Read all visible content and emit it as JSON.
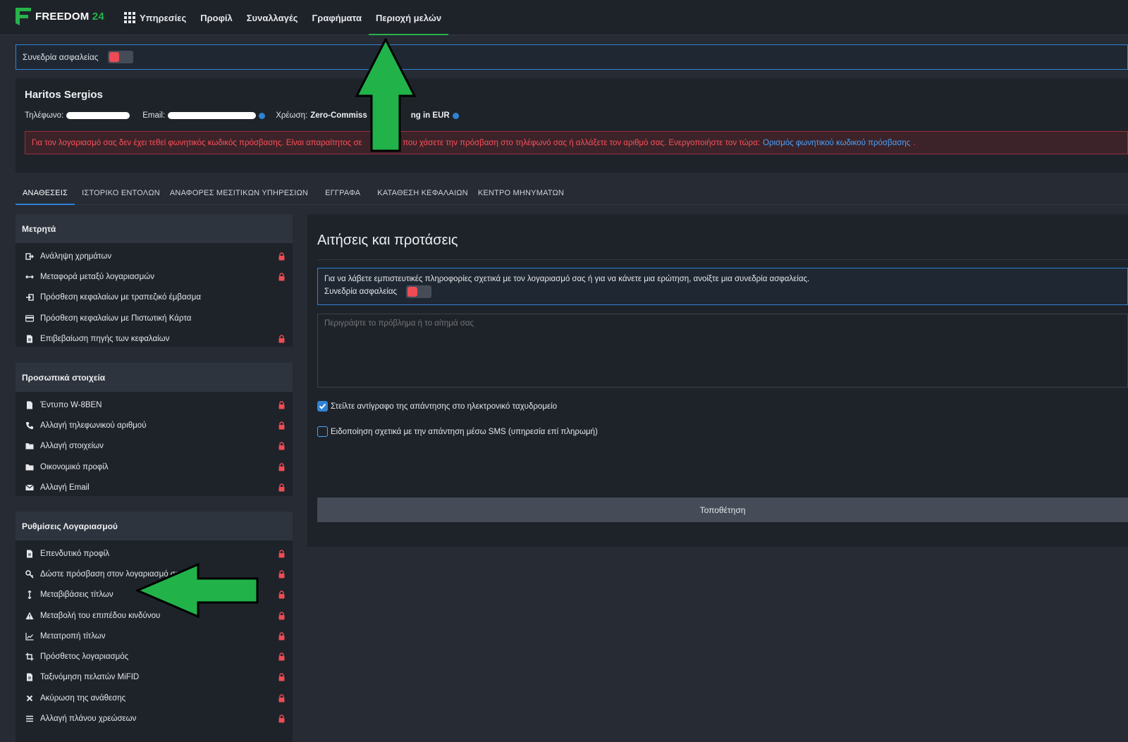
{
  "brand": {
    "name": "FREEDOM",
    "number": "24",
    "green": "#27b24a"
  },
  "nav": [
    {
      "label": "Υπηρεσίες",
      "icon": "apps-grid-icon",
      "active": false
    },
    {
      "label": "Προφίλ",
      "active": false
    },
    {
      "label": "Συναλλαγές",
      "active": false
    },
    {
      "label": "Γραφήματα",
      "active": false
    },
    {
      "label": "Περιοχή μελών",
      "active": true
    }
  ],
  "security_bar": {
    "label": "Συνεδρία ασφαλείας",
    "toggle_on": false
  },
  "profile": {
    "name": "Haritos Sergios",
    "phone_label": "Τηλέφωνο:",
    "email_label": "Email:",
    "charge_label": "Χρέωση:",
    "charge_value": "Zero-Commiss",
    "charge_value_tail": "ng in EUR",
    "warning_text": "Για τον λογαριασμό σας δεν έχει τεθεί φωνητικός κωδικός πρόσβασης. Είναι απαραίτητος σε",
    "warning_text_tail": "η που χάσετε την πρόσβαση στο τηλέφωνό σας ή αλλάξετε τον αριθμό σας. Ενεργοποιήστε τον τώρα:",
    "warning_link": "Ορισμός φωνητικού κωδικού πρόσβασης",
    "warning_end": "."
  },
  "tabs": [
    {
      "label": "ΑΝΑΘΕΣΕΙΣ",
      "active": true
    },
    {
      "label": "ΙΣΤΟΡΙΚΟ ΕΝΤΟΛΩΝ"
    },
    {
      "label": "ΑΝΑΦΟΡΕΣ ΜΕΣΙΤΙΚΩΝ ΥΠΗΡΕΣΙΩΝ"
    },
    {
      "label": "ΕΓΓΡΑΦΑ"
    },
    {
      "label": "ΚΑΤΑΘΕΣΗ ΚΕΦΑΛΑΙΩΝ"
    },
    {
      "label": "ΚΕΝΤΡΟ ΜΗΝΥΜΑΤΩΝ"
    }
  ],
  "sidebar": {
    "cash": {
      "title": "Μετρητά",
      "items": [
        {
          "label": "Ανάληψη χρημάτων",
          "icon": "withdraw-icon",
          "locked": true
        },
        {
          "label": "Μεταφορά μεταξύ λογαριασμών",
          "icon": "transfer-icon",
          "locked": true
        },
        {
          "label": "Πρόσθεση κεφαλαίων με τραπεζικό έμβασμα",
          "icon": "deposit-icon",
          "locked": false
        },
        {
          "label": "Πρόσθεση κεφαλαίων με Πιστωτική Κάρτα",
          "icon": "credit-card-icon",
          "locked": false
        },
        {
          "label": "Επιβεβαίωση πηγής των κεφαλαίων",
          "icon": "document-icon",
          "locked": true
        }
      ]
    },
    "personal": {
      "title": "Προσωπικά στοιχεία",
      "items": [
        {
          "label": "Έντυπο W-8BEN",
          "icon": "document-icon",
          "locked": true
        },
        {
          "label": "Αλλαγή τηλεφωνικού αριθμού",
          "icon": "phone-icon",
          "locked": true
        },
        {
          "label": "Αλλαγή στοιχείων",
          "icon": "folder-icon",
          "locked": true
        },
        {
          "label": "Οικονομικό προφίλ",
          "icon": "folder-icon",
          "locked": true
        },
        {
          "label": "Αλλαγή Email",
          "icon": "envelope-icon",
          "locked": true
        }
      ]
    },
    "account": {
      "title": "Ρυθμίσεις Λογαριασμού",
      "items": [
        {
          "label": "Επενδυτικό προφίλ",
          "icon": "document-icon",
          "locked": true
        },
        {
          "label": "Δώστε πρόσβαση στον λογαριασμό σας",
          "icon": "key-icon",
          "locked": true
        },
        {
          "label": "Μεταβιβάσεις τίτλων",
          "icon": "vertical-arrows-icon",
          "locked": true
        },
        {
          "label": "Μεταβολή του επιπέδου κινδύνου",
          "icon": "warning-icon",
          "locked": true
        },
        {
          "label": "Μετατροπή τίτλων",
          "icon": "line-chart-icon",
          "locked": true
        },
        {
          "label": "Πρόσθετος λογαριασμός",
          "icon": "crop-icon",
          "locked": true
        },
        {
          "label": "Ταξινόμηση πελατών MiFID",
          "icon": "document-icon",
          "locked": true
        },
        {
          "label": "Ακύρωση της ανάθεσης",
          "icon": "cross-icon",
          "locked": true
        },
        {
          "label": "Αλλαγή πλάνου χρεώσεων",
          "icon": "list-icon",
          "locked": true
        }
      ]
    }
  },
  "main": {
    "title": "Αιτήσεις και προτάσεις",
    "info_text": "Για να λάβετε εμπιστευτικές πληροφορίες σχετικά με τον λογαριασμό σας ή για να κάνετε μια ερώτηση, ανοίξτε μια συνεδρία ασφαλείας.",
    "info_toggle_label": "Συνεδρία ασφαλείας",
    "textarea_placeholder": "Περιγράψτε το πρόβλημα ή το αίτημά σας",
    "checkbox_email": {
      "label": "Στείλτε αντίγραφο της απάντησης στο ηλεκτρονικό ταχυδρομείο",
      "checked": true
    },
    "checkbox_sms": {
      "label": "Ειδοποίηση σχετικά με την απάντηση μέσω SMS (υπηρεσία επί πληρωμή)",
      "checked": false
    },
    "submit_label": "Τοποθέτηση"
  },
  "colors": {
    "accent_blue": "#2f82d4",
    "danger_red": "#ef4b55",
    "annotation_green": "#21b24a"
  }
}
